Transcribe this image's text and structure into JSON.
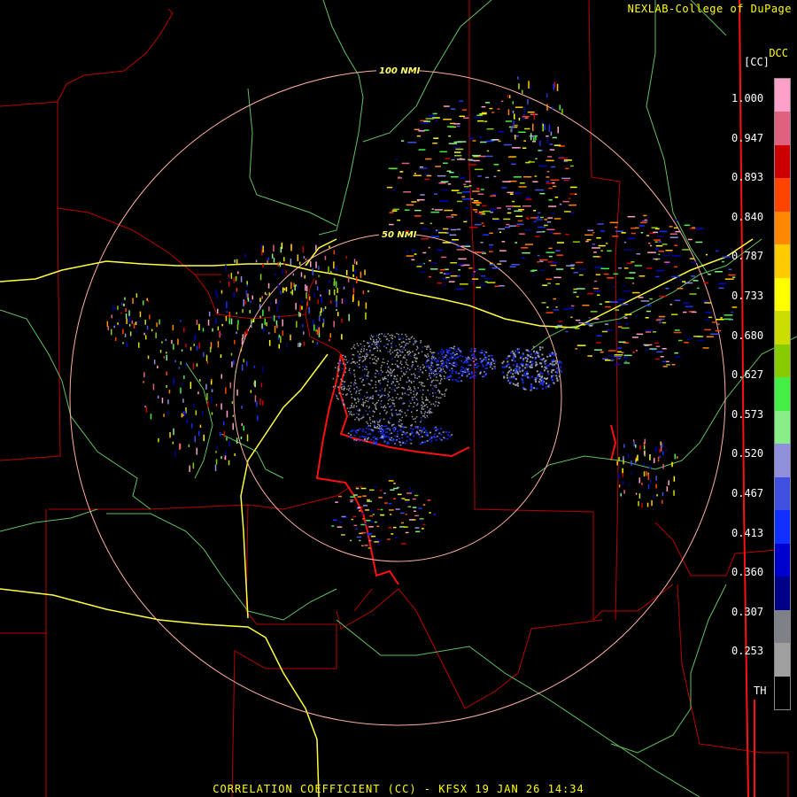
{
  "header": {
    "credit": "NEXLAB-College of DuPage"
  },
  "footer": {
    "title": "CORRELATION COEFFICIENT (CC) - KFSX 19 JAN 26 14:34"
  },
  "map": {
    "ring_labels": [
      "100 NMI",
      "50 NMI"
    ]
  },
  "legend": {
    "product_code": "DCC",
    "unit": "[CC]",
    "labels": [
      "1.000",
      "0.947",
      "0.893",
      "0.840",
      "0.787",
      "0.733",
      "0.680",
      "0.627",
      "0.573",
      "0.520",
      "0.467",
      "0.413",
      "0.360",
      "0.307",
      "0.253",
      "TH"
    ],
    "colors": [
      "#ffa0c8",
      "#e06080",
      "#cc0000",
      "#ff4400",
      "#ff8800",
      "#ffcc00",
      "#ffff00",
      "#ccdd00",
      "#88cc00",
      "#44ee44",
      "#88ee88",
      "#9090dd",
      "#4050e0",
      "#1030ff",
      "#0000cc",
      "#000088",
      "#808088",
      "#a0a0a0",
      "#000000"
    ]
  },
  "colors": {
    "boundary_state": "#ff2020",
    "boundary_county": "#cc0000",
    "roads": "#ffff40",
    "rivers": "#70d070",
    "range_rings": "#ffb0a0",
    "text": "#ffff00"
  }
}
